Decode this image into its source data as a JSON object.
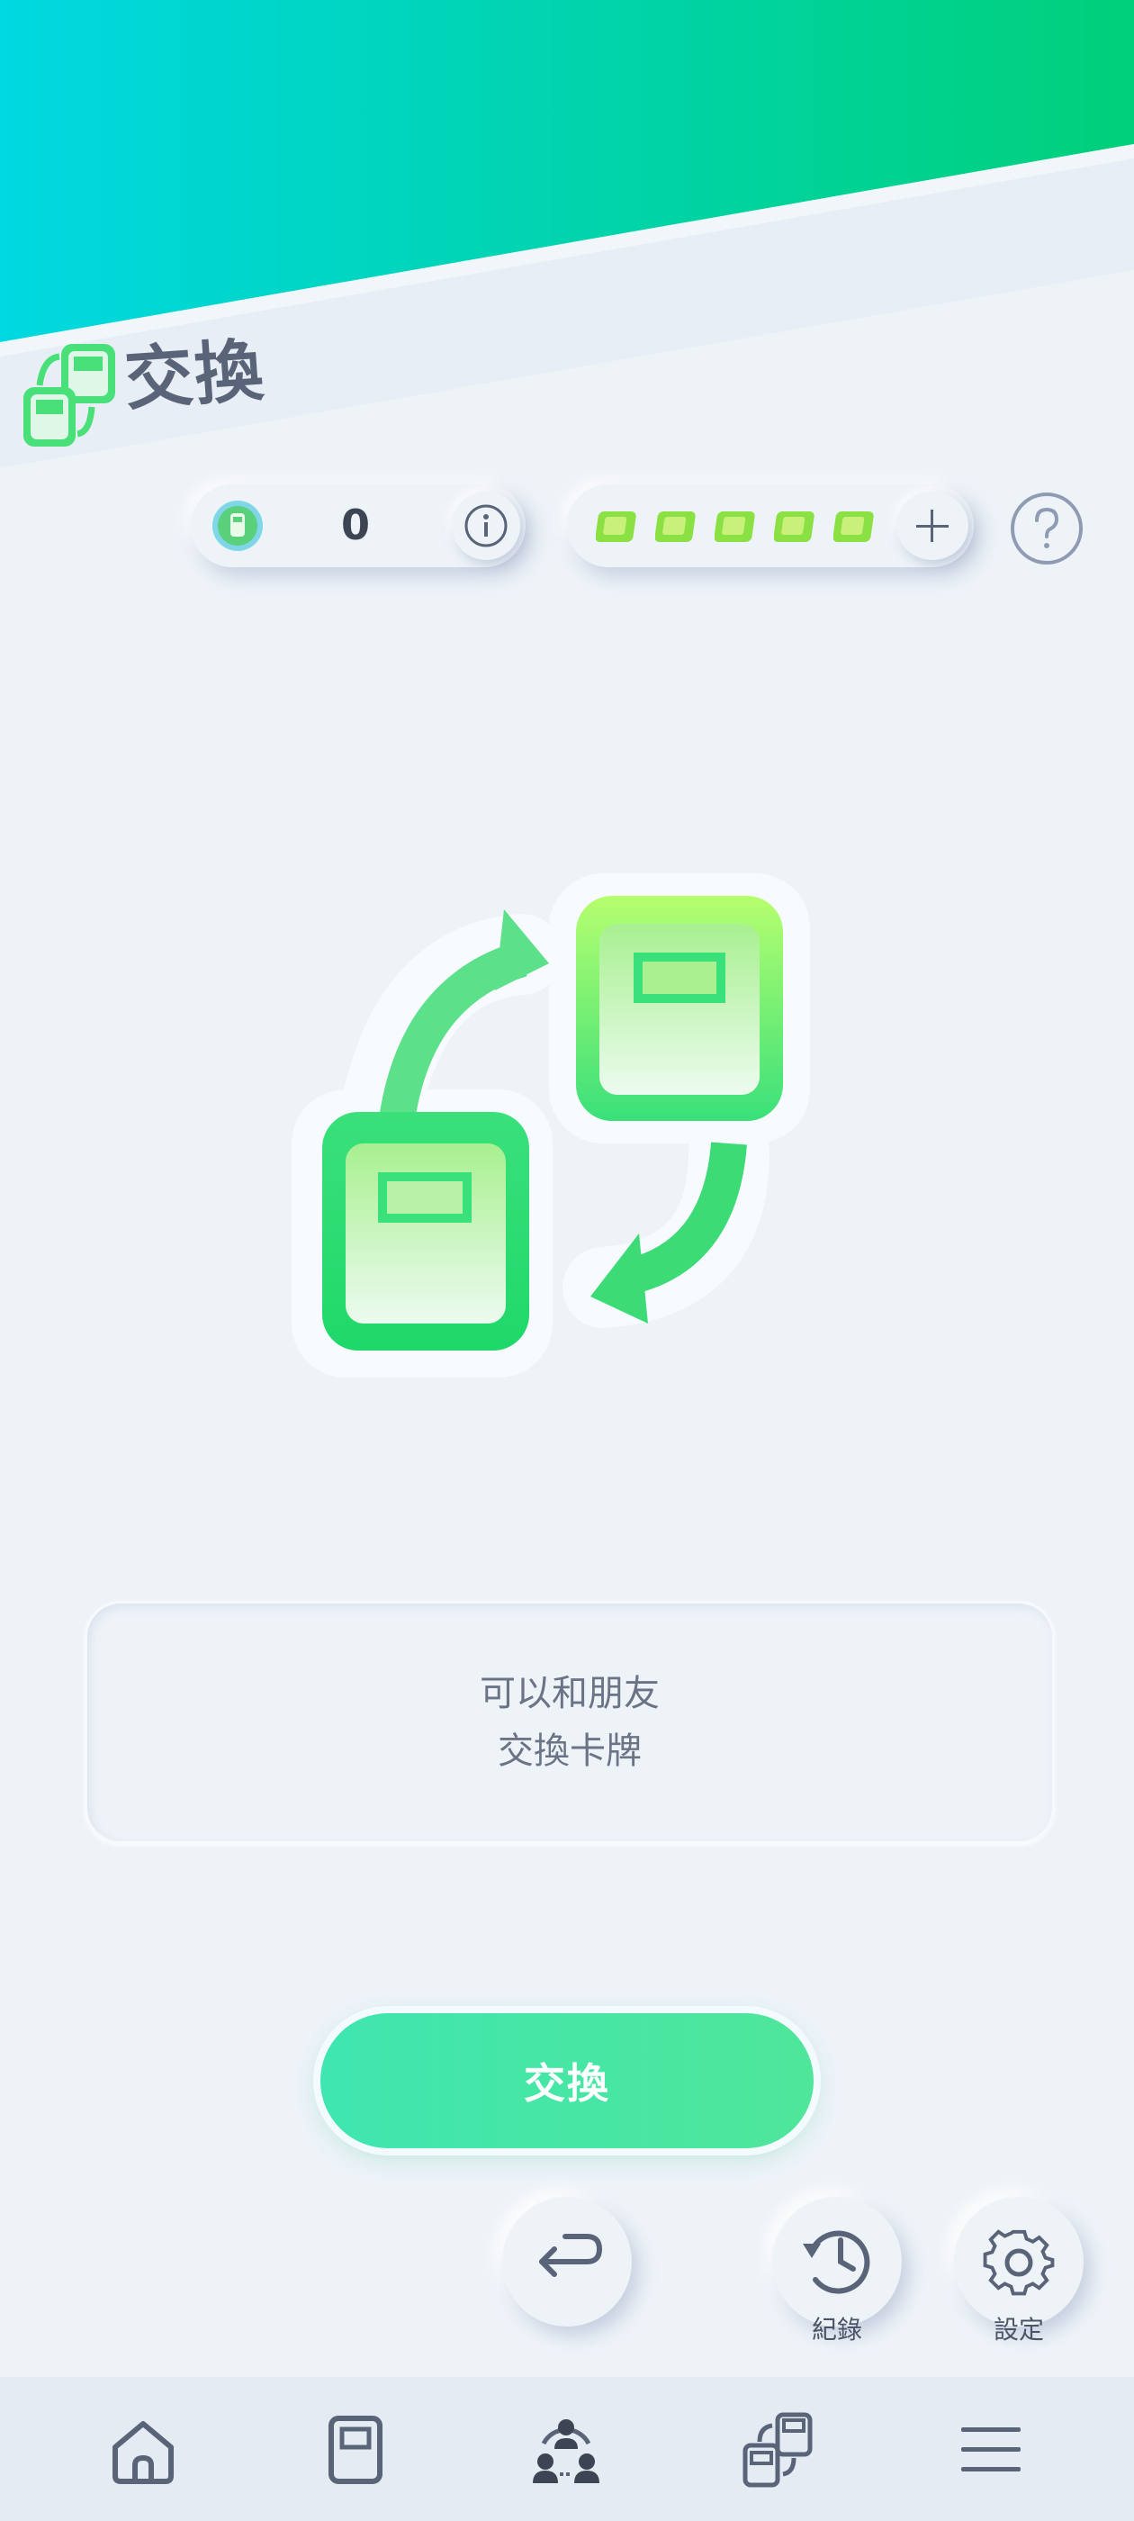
{
  "header": {
    "title": "交換"
  },
  "currency": {
    "coins_value": "0"
  },
  "tickets": {
    "count_shown": 5
  },
  "description": {
    "line1": "可以和朋友",
    "line2": "交換卡牌"
  },
  "actions": {
    "exchange_label": "交換",
    "history_label": "紀錄",
    "settings_label": "設定"
  },
  "colors": {
    "header_gradient_start": "#00d8e2",
    "header_gradient_end": "#00d07a",
    "accent_green": "#3fe6b0",
    "icon_gray": "#5a6478"
  },
  "icons": [
    "exchange-icon",
    "coin-icon",
    "info-icon",
    "ticket-icon",
    "plus-icon",
    "help-icon",
    "back-icon",
    "history-icon",
    "gear-icon",
    "home-icon",
    "card-icon",
    "friends-icon",
    "trade-icon",
    "menu-icon"
  ]
}
